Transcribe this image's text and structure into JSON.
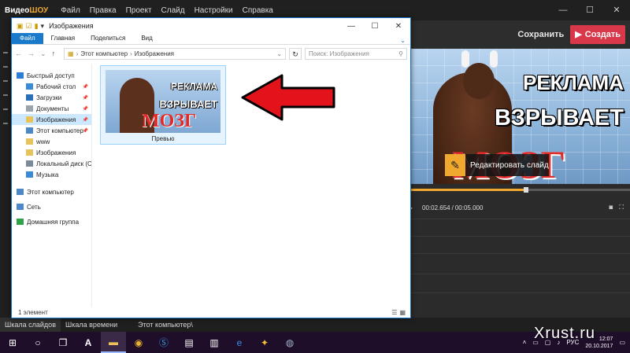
{
  "app": {
    "logo_part1": "Видео",
    "logo_part2": "ШОУ",
    "menu": [
      "Файл",
      "Правка",
      "Проект",
      "Слайд",
      "Настройки",
      "Справка"
    ],
    "save_label": "Сохранить",
    "create_label": "Создать",
    "preview_line1": "РЕКЛАМА",
    "preview_line2": "ВЗРЫВАЕТ",
    "preview_line3": "МОЗГ",
    "edit_slide_label": "Редактировать слайд",
    "time_current": "00:02.654",
    "time_separator": "/",
    "time_total": "00:05.000",
    "playback_progress": 0.53,
    "bottom_tabs": [
      "Шкала слайдов",
      "Шкала времени"
    ],
    "bottom_crumb": "Этот компьютер\\"
  },
  "explorer": {
    "title": "Изображения",
    "ribbon_tabs": [
      "Файл",
      "Главная",
      "Поделиться",
      "Вид"
    ],
    "address": [
      "Этот компьютер",
      "Изображения"
    ],
    "search_placeholder": "Поиск: Изображения",
    "nav": [
      {
        "label": "Быстрый доступ",
        "icon": "star-icon",
        "sub": false,
        "pin": false,
        "sel": false,
        "color": "#2b7fd4"
      },
      {
        "label": "Рабочий стол",
        "icon": "desktop-folder-icon",
        "sub": true,
        "pin": true,
        "sel": false,
        "color": "#3a8ad6"
      },
      {
        "label": "Загрузки",
        "icon": "downloads-icon",
        "sub": true,
        "pin": true,
        "sel": false,
        "color": "#2a6fb8"
      },
      {
        "label": "Документы",
        "icon": "documents-icon",
        "sub": true,
        "pin": true,
        "sel": false,
        "color": "#9aa4ad"
      },
      {
        "label": "Изображения",
        "icon": "pictures-icon",
        "sub": true,
        "pin": true,
        "sel": true,
        "color": "#e8c25a"
      },
      {
        "label": "Этот компьютер",
        "icon": "computer-icon",
        "sub": true,
        "pin": true,
        "sel": false,
        "color": "#4c88c6"
      },
      {
        "label": "www",
        "icon": "folder-icon",
        "sub": true,
        "pin": false,
        "sel": false,
        "color": "#e8c25a"
      },
      {
        "label": "Изображения",
        "icon": "pictures-icon",
        "sub": true,
        "pin": false,
        "sel": false,
        "color": "#e8c25a"
      },
      {
        "label": "Локальный диск (C:",
        "icon": "drive-icon",
        "sub": true,
        "pin": false,
        "sel": false,
        "color": "#7a8a99"
      },
      {
        "label": "Музыка",
        "icon": "music-icon",
        "sub": true,
        "pin": false,
        "sel": false,
        "color": "#3a8ad6"
      },
      {
        "label": "Этот компьютер",
        "icon": "computer-icon",
        "sub": false,
        "pin": false,
        "sel": false,
        "color": "#4c88c6"
      },
      {
        "label": "Сеть",
        "icon": "network-icon",
        "sub": false,
        "pin": false,
        "sel": false,
        "color": "#4c88c6"
      },
      {
        "label": "Домашняя группа",
        "icon": "homegroup-icon",
        "sub": false,
        "pin": false,
        "sel": false,
        "color": "#2ea34a"
      }
    ],
    "file": {
      "name": "Превью",
      "thumb_line1": "РЕКЛАМА",
      "thumb_line2": "ВЗРЫВАЕТ",
      "thumb_line3": "МОЗГ"
    },
    "status": "1 элемент"
  },
  "taskbar": {
    "language": "РУС",
    "time": "12:07",
    "date": "20.10.2017"
  },
  "watermark": "Xrust.ru",
  "colors": {
    "accent": "#f0a92e",
    "create": "#d8384a",
    "arrow": "#e3131b",
    "explorer_border": "#1a73c8"
  }
}
